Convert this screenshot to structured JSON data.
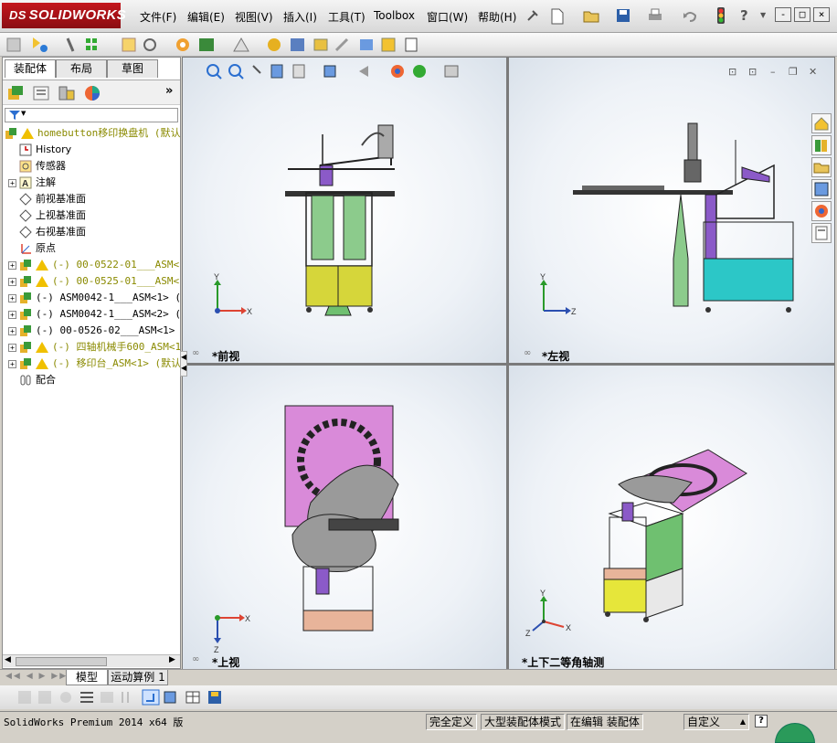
{
  "app": {
    "logo_text": "SOLIDWORKS",
    "logo_ds": "DS"
  },
  "menu": [
    "文件(F)",
    "编辑(E)",
    "视图(V)",
    "插入(I)",
    "工具(T)",
    "Toolbox",
    "窗口(W)",
    "帮助(H)"
  ],
  "window_controls": {
    "minimize": "-",
    "restore": "□",
    "close": "×"
  },
  "left_tabs": [
    "装配体",
    "布局",
    "草图"
  ],
  "tree": {
    "root": "homebutton移印换盘机  (默认",
    "items": [
      {
        "label": "History",
        "type": "history"
      },
      {
        "label": "传感器",
        "type": "sensor"
      },
      {
        "label": "注解",
        "type": "annotation"
      },
      {
        "label": "前视基准面",
        "type": "plane"
      },
      {
        "label": "上视基准面",
        "type": "plane"
      },
      {
        "label": "右视基准面",
        "type": "plane"
      },
      {
        "label": "原点",
        "type": "origin"
      },
      {
        "label": "(-) 00-0522-01___ASM<1>",
        "type": "asm-warn"
      },
      {
        "label": "(-) 00-0525-01___ASM<1>",
        "type": "asm-warn"
      },
      {
        "label": "(-) ASM0042-1___ASM<1> (默",
        "type": "asm"
      },
      {
        "label": "(-) ASM0042-1___ASM<2> (默",
        "type": "asm"
      },
      {
        "label": "(-) 00-0526-02___ASM<1> (",
        "type": "asm"
      },
      {
        "label": "(-) 四轴机械手600_ASM<1>",
        "type": "asm-warn"
      },
      {
        "label": "(-) 移印台_ASM<1> (默认",
        "type": "asm-warn"
      },
      {
        "label": "配合",
        "type": "mates"
      }
    ]
  },
  "viewports": [
    {
      "label": "*前视",
      "axes": [
        "Y",
        "X"
      ]
    },
    {
      "label": "*左视",
      "axes": [
        "Y",
        "Z"
      ]
    },
    {
      "label": "*上视",
      "axes": [
        "X",
        "Z"
      ]
    },
    {
      "label": "*上下二等角轴测",
      "axes": [
        "Y",
        "X",
        "Z"
      ]
    }
  ],
  "bottom_tabs": [
    "模型",
    "运动算例 1"
  ],
  "status": {
    "product": "SolidWorks Premium 2014 x64 版",
    "cells": [
      "完全定义",
      "大型装配体模式",
      "在编辑 装配体",
      "自定义"
    ],
    "help": "?"
  },
  "colors": {
    "accent": "#c4161c",
    "warn": "#f0c000",
    "tree_olive": "#8a8a00"
  }
}
